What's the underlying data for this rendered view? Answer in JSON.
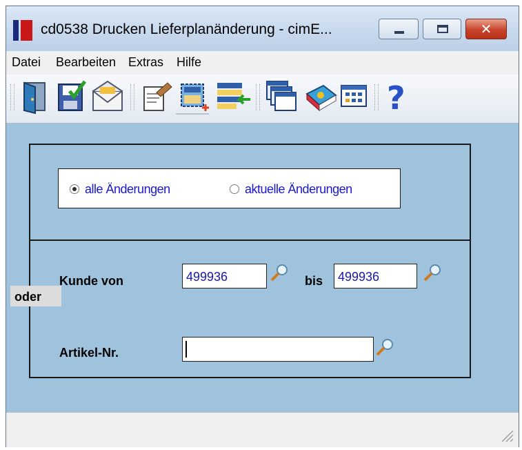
{
  "window": {
    "title": "cd0538 Drucken Lieferplanänderung - cimE..."
  },
  "menu": {
    "items": [
      "Datei",
      "Bearbeiten",
      "Extras",
      "Hilfe"
    ]
  },
  "toolbar": {
    "icons": [
      "exit-door-icon",
      "save-icon",
      "mail-icon",
      "edit-document-icon",
      "new-selection-icon",
      "import-list-icon",
      "windows-icon",
      "book-icon",
      "grid-icon",
      "help-icon"
    ]
  },
  "options": {
    "radio1_label": "alle Änderungen",
    "radio1_checked": true,
    "radio2_label": "aktuelle Änderungen",
    "radio2_checked": false
  },
  "filter": {
    "kunde_label": "Kunde von",
    "kunde_from": "499936",
    "bis_label": "bis",
    "kunde_to": "499936",
    "oder_label": "oder",
    "artikel_label": "Artikel-Nr.",
    "artikel_value": ""
  },
  "colors": {
    "content_bg": "#9fc3dc",
    "radio_text": "#1818c8",
    "input_text": "#1818b0"
  }
}
